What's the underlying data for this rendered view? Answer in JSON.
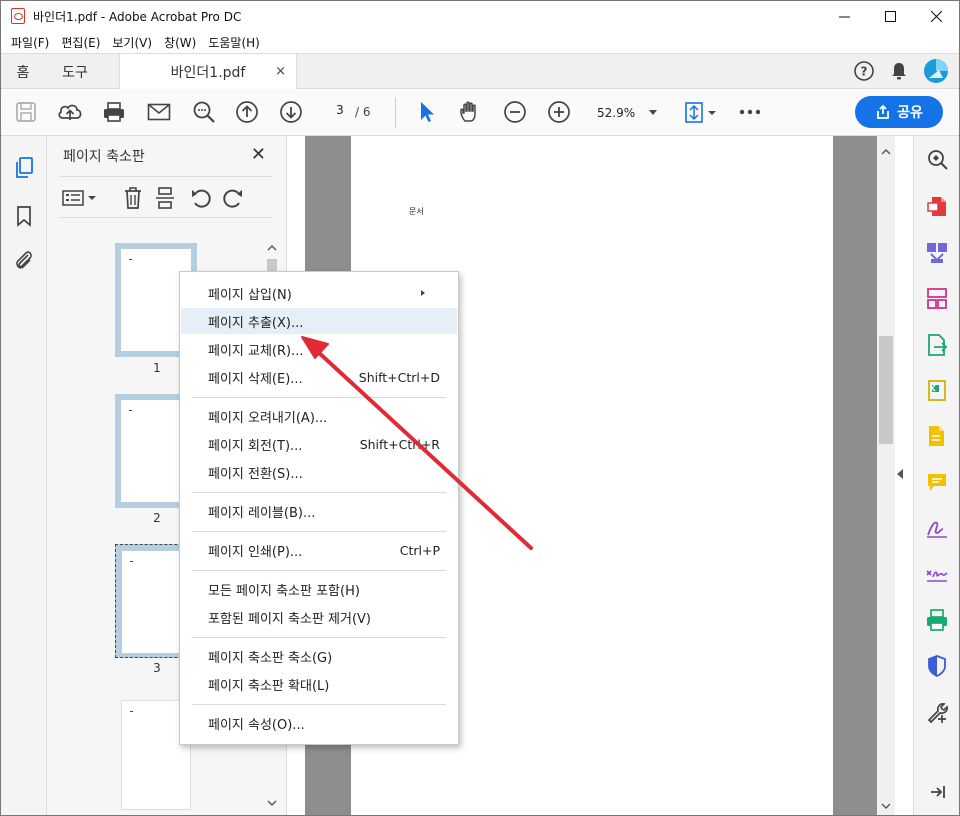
{
  "window": {
    "title": "바인더1.pdf - Adobe Acrobat Pro DC"
  },
  "menubar": [
    "파일(F)",
    "편집(E)",
    "보기(V)",
    "창(W)",
    "도움말(H)"
  ],
  "tabs": {
    "home": "홈",
    "tools": "도구",
    "document": "바인더1.pdf",
    "close": "×"
  },
  "toolbar": {
    "current_page": "3",
    "total_pages": "/  6",
    "zoom": "52.9%",
    "share_label": "공유"
  },
  "thumbnail_panel": {
    "title": "페이지 축소판",
    "close": "✕",
    "thumbs": [
      {
        "number": "1"
      },
      {
        "number": "2"
      },
      {
        "number": "3"
      }
    ]
  },
  "document": {
    "text": "문서"
  },
  "context_menu": {
    "items": [
      {
        "label": "페이지 삽입(N)",
        "shortcut": "",
        "submenu": true
      },
      {
        "label": "페이지 추출(X)...",
        "shortcut": ""
      },
      {
        "label": "페이지 교체(R)...",
        "shortcut": ""
      },
      {
        "label": "페이지 삭제(E)...",
        "shortcut": "Shift+Ctrl+D"
      },
      {
        "label": "페이지 오려내기(A)...",
        "shortcut": ""
      },
      {
        "label": "페이지 회전(T)...",
        "shortcut": "Shift+Ctrl+R"
      },
      {
        "label": "페이지 전환(S)...",
        "shortcut": ""
      },
      {
        "label": "페이지 레이블(B)...",
        "shortcut": ""
      },
      {
        "label": "페이지 인쇄(P)...",
        "shortcut": "Ctrl+P"
      },
      {
        "label": "모든 페이지 축소판 포함(H)",
        "shortcut": ""
      },
      {
        "label": "포함된 페이지 축소판 제거(V)",
        "shortcut": ""
      },
      {
        "label": "페이지 축소판 축소(G)",
        "shortcut": ""
      },
      {
        "label": "페이지 축소판 확대(L)",
        "shortcut": ""
      },
      {
        "label": "페이지 속성(O)...",
        "shortcut": ""
      }
    ]
  },
  "colors": {
    "accent": "#1473e6",
    "annotation_arrow": "#e02b35",
    "menu_highlight": "#e6eef7"
  }
}
